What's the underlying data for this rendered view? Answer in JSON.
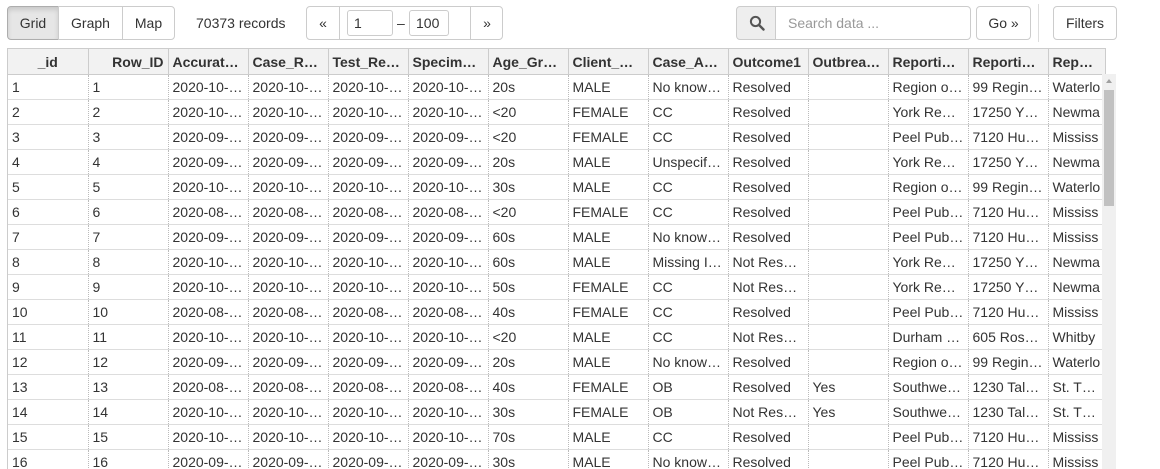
{
  "toolbar": {
    "tabs": [
      {
        "label": "Grid",
        "active": true
      },
      {
        "label": "Graph",
        "active": false
      },
      {
        "label": "Map",
        "active": false
      }
    ],
    "record_count": "70373 records",
    "pager": {
      "prev": "«",
      "next": "»",
      "from": "1",
      "separator": "–",
      "to": "100"
    },
    "search": {
      "icon": "search-icon",
      "placeholder": "Search data ...",
      "go_label": "Go »"
    },
    "filters_label": "Filters"
  },
  "grid": {
    "columns": [
      "_id",
      "Row_ID",
      "Accurat…",
      "Case_R…",
      "Test_Re…",
      "Specim…",
      "Age_Gr…",
      "Client_…",
      "Case_A…",
      "Outcome1",
      "Outbrea…",
      "Reporti…",
      "Reporti…",
      "Reporti…"
    ],
    "rows": [
      [
        "1",
        "1",
        "2020-10-…",
        "2020-10-…",
        "2020-10-…",
        "2020-10-…",
        "20s",
        "MALE",
        "No know…",
        "Resolved",
        "",
        "Region o…",
        "99 Regin…",
        "Waterlo"
      ],
      [
        "2",
        "2",
        "2020-10-…",
        "2020-10-…",
        "2020-10-…",
        "2020-10-…",
        "<20",
        "FEMALE",
        "CC",
        "Resolved",
        "",
        "York Re…",
        "17250 Y…",
        "Newma"
      ],
      [
        "3",
        "3",
        "2020-09-…",
        "2020-09-…",
        "2020-09-…",
        "2020-09-…",
        "<20",
        "FEMALE",
        "CC",
        "Resolved",
        "",
        "Peel Pub…",
        "7120 Hu…",
        "Mississ"
      ],
      [
        "4",
        "4",
        "2020-09-…",
        "2020-09-…",
        "2020-09-…",
        "2020-09-…",
        "20s",
        "MALE",
        "Unspecif…",
        "Resolved",
        "",
        "York Re…",
        "17250 Y…",
        "Newma"
      ],
      [
        "5",
        "5",
        "2020-10-…",
        "2020-10-…",
        "2020-10-…",
        "2020-10-…",
        "30s",
        "MALE",
        "CC",
        "Resolved",
        "",
        "Region o…",
        "99 Regin…",
        "Waterlo"
      ],
      [
        "6",
        "6",
        "2020-08-…",
        "2020-08-…",
        "2020-08-…",
        "2020-08-…",
        "<20",
        "FEMALE",
        "CC",
        "Resolved",
        "",
        "Peel Pub…",
        "7120 Hu…",
        "Mississ"
      ],
      [
        "7",
        "7",
        "2020-09-…",
        "2020-09-…",
        "2020-09-…",
        "2020-09-…",
        "60s",
        "MALE",
        "No know…",
        "Resolved",
        "",
        "Peel Pub…",
        "7120 Hu…",
        "Mississ"
      ],
      [
        "8",
        "8",
        "2020-10-…",
        "2020-10-…",
        "2020-10-…",
        "2020-10-…",
        "60s",
        "MALE",
        "Missing I…",
        "Not Res…",
        "",
        "York Re…",
        "17250 Y…",
        "Newma"
      ],
      [
        "9",
        "9",
        "2020-10-…",
        "2020-10-…",
        "2020-10-…",
        "2020-10-…",
        "50s",
        "FEMALE",
        "CC",
        "Not Res…",
        "",
        "York Re…",
        "17250 Y…",
        "Newma"
      ],
      [
        "10",
        "10",
        "2020-08-…",
        "2020-08-…",
        "2020-08-…",
        "2020-08-…",
        "40s",
        "FEMALE",
        "CC",
        "Resolved",
        "",
        "Peel Pub…",
        "7120 Hu…",
        "Mississ"
      ],
      [
        "11",
        "11",
        "2020-10-…",
        "2020-10-…",
        "2020-10-…",
        "2020-10-…",
        "<20",
        "MALE",
        "CC",
        "Not Res…",
        "",
        "Durham …",
        "605 Ros…",
        "Whitby"
      ],
      [
        "12",
        "12",
        "2020-09-…",
        "2020-09-…",
        "2020-09-…",
        "2020-09-…",
        "20s",
        "MALE",
        "No know…",
        "Resolved",
        "",
        "Region o…",
        "99 Regin…",
        "Waterlo"
      ],
      [
        "13",
        "13",
        "2020-08-…",
        "2020-08-…",
        "2020-08-…",
        "2020-08-…",
        "40s",
        "FEMALE",
        "OB",
        "Resolved",
        "Yes",
        "Southwe…",
        "1230 Tal…",
        "St. Thor"
      ],
      [
        "14",
        "14",
        "2020-10-…",
        "2020-10-…",
        "2020-10-…",
        "2020-10-…",
        "30s",
        "FEMALE",
        "OB",
        "Not Res…",
        "Yes",
        "Southwe…",
        "1230 Tal…",
        "St. Thor"
      ],
      [
        "15",
        "15",
        "2020-10-…",
        "2020-10-…",
        "2020-10-…",
        "2020-10-…",
        "70s",
        "MALE",
        "CC",
        "Resolved",
        "",
        "Peel Pub…",
        "7120 Hu…",
        "Mississ"
      ],
      [
        "16",
        "16",
        "2020-09-…",
        "2020-09-…",
        "2020-09-…",
        "2020-09-…",
        "30s",
        "MALE",
        "No know…",
        "Resolved",
        "",
        "Peel Pub…",
        "7120 Hu…",
        "Mississ"
      ]
    ]
  }
}
